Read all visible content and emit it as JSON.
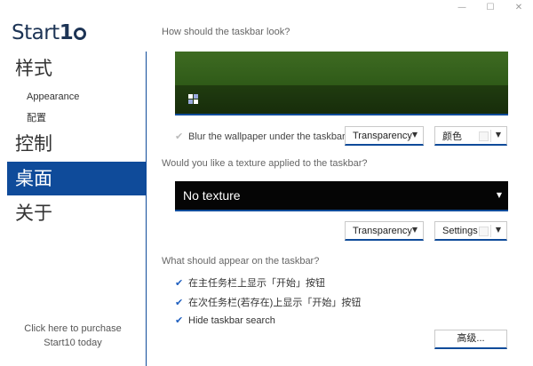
{
  "window": {
    "minimize": "—",
    "maximize": "☐",
    "close": "✕"
  },
  "sidebar": {
    "logo_prefix": "Start",
    "logo_ten": "1",
    "nav": [
      {
        "label": "样式",
        "active": false
      },
      {
        "label": "控制",
        "active": false
      },
      {
        "label": "桌面",
        "active": true
      },
      {
        "label": "关于",
        "active": false
      }
    ],
    "sub_items": [
      "Appearance",
      "配置"
    ],
    "purchase_line1": "Click here to purchase",
    "purchase_line2": "Start10 today"
  },
  "look_section": {
    "heading": "How should the taskbar look?",
    "blur_label": "Blur the wallpaper under the taskbar",
    "blur_checked": true,
    "transparency_label": "Transparency",
    "color_label": "颜色"
  },
  "texture_section": {
    "heading": "Would you like a texture applied to the taskbar?",
    "selected": "No texture",
    "transparency_label": "Transparency",
    "settings_label": "Settings"
  },
  "appear_section": {
    "heading": "What should appear on the taskbar?",
    "options": [
      {
        "label": "在主任务栏上显示「开始」按钮",
        "checked": true
      },
      {
        "label": "在次任务栏(若存在)上显示「开始」按钮",
        "checked": true
      },
      {
        "label": "Hide taskbar search",
        "checked": true
      }
    ],
    "advanced_label": "高级..."
  },
  "colors": {
    "accent": "#0f4b9a",
    "taskbar_preview": "#2f5a18",
    "check": "#1f5fbf"
  }
}
